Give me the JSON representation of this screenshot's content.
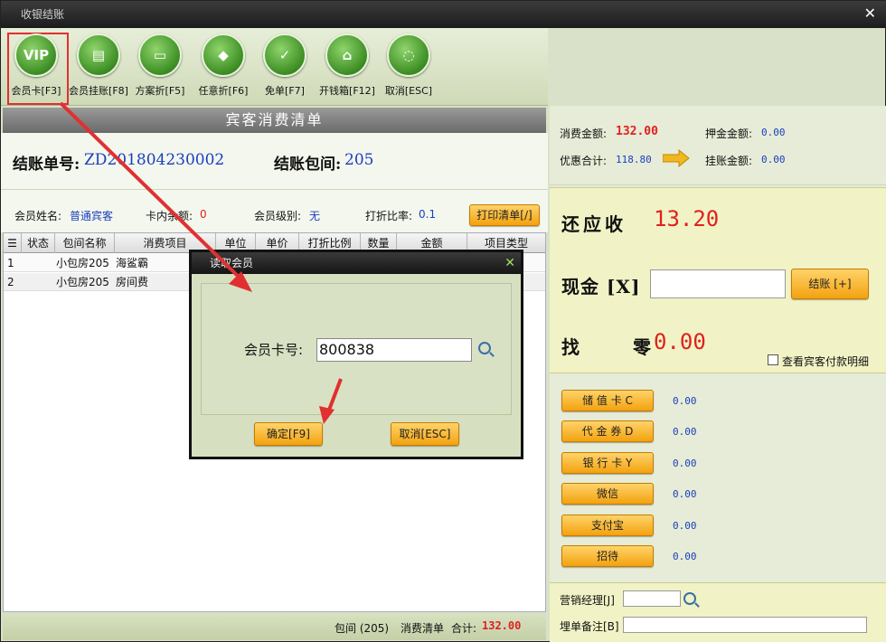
{
  "window": {
    "title": "收银结账"
  },
  "toolbar": {
    "items": [
      {
        "label": "会员卡[F3]",
        "glyph": "VIP",
        "icon": "vip-icon"
      },
      {
        "label": "会员挂账[F8]",
        "glyph": "▤",
        "icon": "document-icon"
      },
      {
        "label": "方案折[F5]",
        "glyph": "▭",
        "icon": "window-icon"
      },
      {
        "label": "任意折[F6]",
        "glyph": "◆",
        "icon": "tag-icon"
      },
      {
        "label": "免单[F7]",
        "glyph": "✓",
        "icon": "clipboard-check-icon"
      },
      {
        "label": "开钱箱[F12]",
        "glyph": "⌂",
        "icon": "cash-box-icon"
      },
      {
        "label": "取消[ESC]",
        "glyph": "◌",
        "icon": "cancel-icon"
      }
    ]
  },
  "list": {
    "header": "宾客消费清单",
    "bill_no_label": "结账单号:",
    "bill_no": "ZD201804230002",
    "room_label": "结账包间:",
    "room_no": "205",
    "member_name_label": "会员姓名:",
    "member_name": "普通宾客",
    "card_balance_label": "卡内余额:",
    "card_balance": "0",
    "member_level_label": "会员级别:",
    "member_level": "无",
    "discount_label": "打折比率:",
    "discount": "0.1",
    "print_button": "打印清单[/]",
    "columns": [
      "状态",
      "包间名称",
      "消费项目",
      "单位",
      "单价",
      "打折比例",
      "数量",
      "金额",
      "项目类型"
    ],
    "rows": [
      {
        "index": "1",
        "status": "",
        "room": "小包房205",
        "item": "海鲨霸"
      },
      {
        "index": "2",
        "status": "",
        "room": "小包房205",
        "item": "房间费"
      }
    ],
    "footer": {
      "room": "包间 (205)",
      "list_label": "消费清单",
      "total_label": "合计:",
      "total": "132.00"
    }
  },
  "summary": {
    "consume_label": "消费金额:",
    "consume": "132.00",
    "deposit_label": "押金金额:",
    "deposit": "0.00",
    "discount_total_label": "优惠合计:",
    "discount_total": "118.80",
    "credit_label": "挂账金额:",
    "credit": "0.00"
  },
  "payment": {
    "due_label": "还应收",
    "due": "13.20",
    "cash_label": "现金 [X]",
    "checkout_button": "结账 [+]",
    "change_label": "找 零",
    "change": "0.00",
    "detail_checkbox": "查看宾客付款明细"
  },
  "methods": [
    {
      "label": "储 值 卡 C",
      "value": "0.00"
    },
    {
      "label": "代 金 券 D",
      "value": "0.00"
    },
    {
      "label": "银 行 卡 Y",
      "value": "0.00"
    },
    {
      "label": "微信",
      "value": "0.00"
    },
    {
      "label": "支付宝",
      "value": "0.00"
    },
    {
      "label": "招待",
      "value": "0.00"
    }
  ],
  "bottom": {
    "manager_label": "营销经理[J]",
    "remark_label": "埋单备注[B]"
  },
  "dialog": {
    "title": "读取会员",
    "label": "会员卡号:",
    "card_value": "800838",
    "ok": "确定[F9]",
    "cancel": "取消[ESC]"
  },
  "colors": {
    "accent": "#f3a20f",
    "amount_red": "#e02020",
    "value_blue": "#1a3fbf",
    "annotation": "#e03030"
  }
}
